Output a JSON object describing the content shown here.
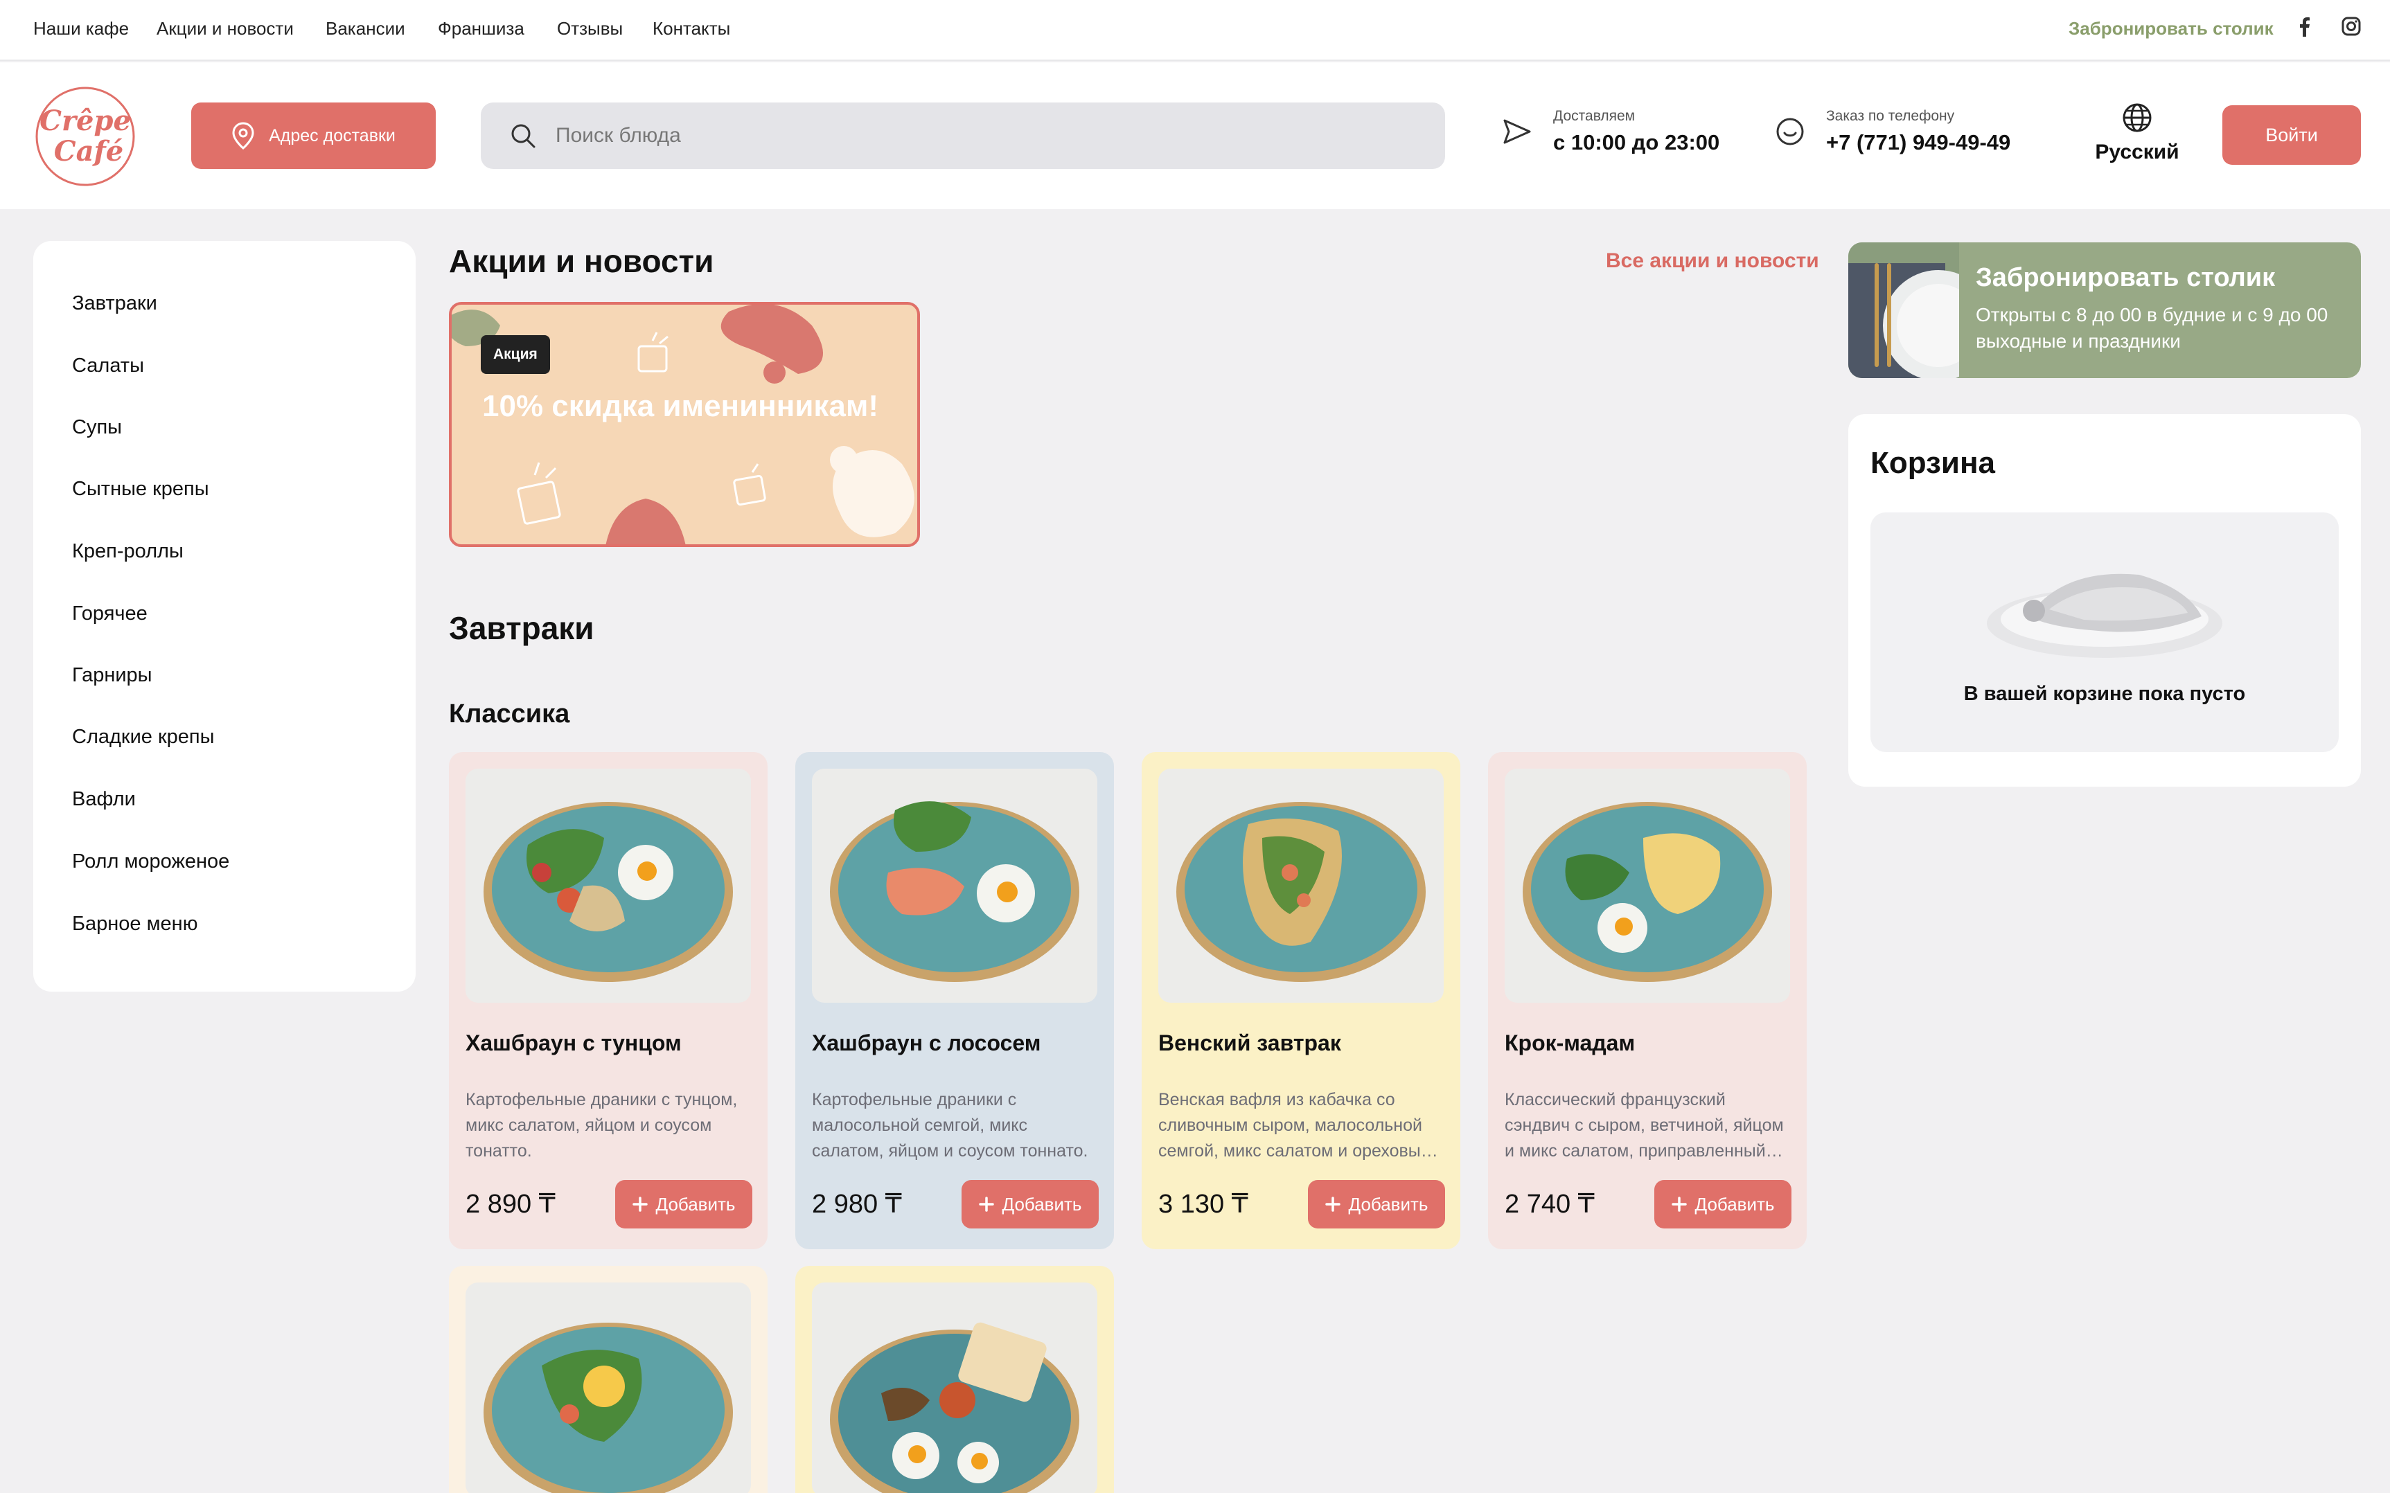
{
  "topnav": {
    "links": [
      "Наши кафе",
      "Акции и новости",
      "Вакансии",
      "Франшиза",
      "Отзывы",
      "Контакты"
    ],
    "book_table": "Забронировать столик"
  },
  "header": {
    "logo_text": [
      "Crêpe",
      "Café"
    ],
    "address_button": "Адрес доставки",
    "search_placeholder": "Поиск блюда",
    "delivery_label": "Доставляем",
    "delivery_hours": "с 10:00 до 23:00",
    "phone_label": "Заказ по телефону",
    "phone": "+7 (771) 949-49-49",
    "language": "Русский",
    "login": "Войти"
  },
  "sidebar": {
    "items": [
      "Завтраки",
      "Салаты",
      "Супы",
      "Сытные крепы",
      "Креп-роллы",
      "Горячее",
      "Гарниры",
      "Сладкие крепы",
      "Вафли",
      "Ролл мороженое",
      "Барное меню"
    ]
  },
  "promo": {
    "heading": "Акции и новости",
    "all_link": "Все акции и новости",
    "badge": "Акция",
    "text": "10% скидка именинникам!"
  },
  "breakfast": {
    "heading": "Завтраки",
    "subheading": "Классика",
    "cards": [
      {
        "title": "Хашбраун с тунцом",
        "desc": "Картофельные драники с тунцом, микс салатом, яйцом и соусом тонатто.",
        "price": "2 890 ₸",
        "add": "Добавить",
        "bg": "#f5e4e2"
      },
      {
        "title": "Хашбраун с лососем",
        "desc": "Картофельные драники с малосольной семгой, микс салатом, яйцом и соусом тоннато.",
        "price": "2 980 ₸",
        "add": "Добавить",
        "bg": "#d9e2ea"
      },
      {
        "title": "Венский завтрак",
        "desc": "Венская вафля из кабачка со сливочным сыром, малосольной семгой, микс салатом и ореховы…",
        "price": "3 130 ₸",
        "add": "Добавить",
        "bg": "#fbf1c6"
      },
      {
        "title": "Крок-мадам",
        "desc": "Классический французский сэндвич с сыром, ветчиной, яйцом и микс салатом, приправленный…",
        "price": "2 740 ₸",
        "add": "Добавить",
        "bg": "#f5e4e2"
      }
    ],
    "row2_bgs": [
      "#fbf1e2",
      "#fbf1c6"
    ]
  },
  "booking": {
    "title": "Забронировать столик",
    "subtitle": "Открыты с 8 до 00 в будние и с 9 до 00 выходные и праздники"
  },
  "cart": {
    "title": "Корзина",
    "empty": "В вашей корзине пока пусто"
  },
  "colors": {
    "accent": "#e07069",
    "olive": "#8a9e6b",
    "page_bg": "#f1f0f2"
  }
}
